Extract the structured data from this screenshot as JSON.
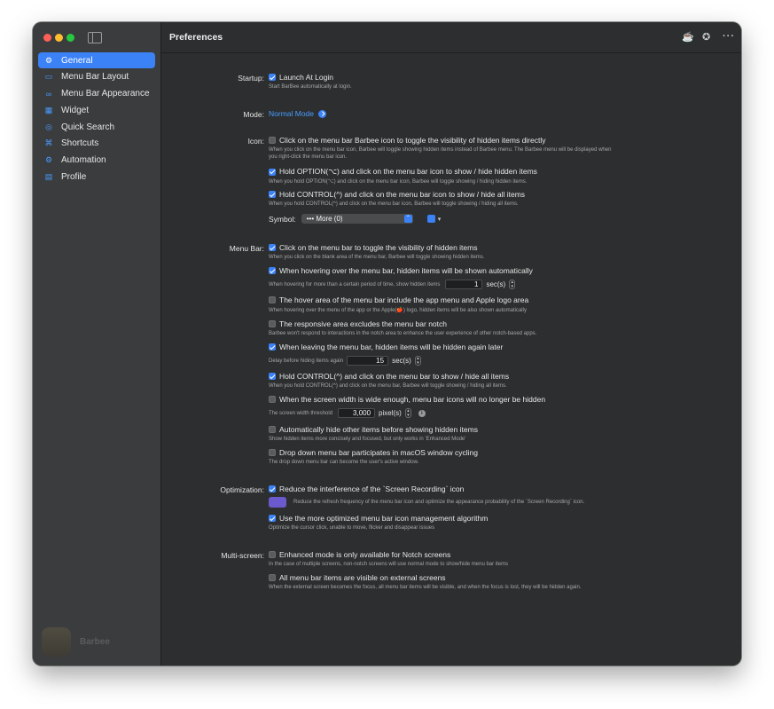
{
  "sidebar": {
    "items": [
      {
        "label": "General",
        "icon": "gear-icon",
        "glyph": "⚙",
        "active": true
      },
      {
        "label": "Menu Bar Layout",
        "icon": "layout-icon",
        "glyph": "▭",
        "active": false
      },
      {
        "label": "Menu Bar Appearance",
        "icon": "appearance-icon",
        "glyph": "∞",
        "active": false
      },
      {
        "label": "Widget",
        "icon": "widget-icon",
        "glyph": "▦",
        "active": false
      },
      {
        "label": "Quick Search",
        "icon": "search-icon",
        "glyph": "◎",
        "active": false
      },
      {
        "label": "Shortcuts",
        "icon": "shortcuts-icon",
        "glyph": "⌘",
        "active": false
      },
      {
        "label": "Automation",
        "icon": "automation-icon",
        "glyph": "⚙",
        "active": false
      },
      {
        "label": "Profile",
        "icon": "profile-icon",
        "glyph": "▤",
        "active": false
      }
    ],
    "brand_name": "Barbee"
  },
  "header": {
    "title": "Preferences"
  },
  "startup": {
    "label": "Startup:",
    "launch": {
      "label": "Launch At Login",
      "checked": true,
      "desc": "Start BarBee automatically at login."
    }
  },
  "mode": {
    "label": "Mode:",
    "value": "Normal Mode"
  },
  "icon": {
    "label": "Icon:",
    "items": [
      {
        "label": "Click on the menu bar Barbee icon to toggle the visibility of hidden items directly",
        "checked": false,
        "desc1": "When you click on the menu bar icon, Barbee will toggle showing hidden items instead of Barbee menu. The Barbee menu will be displayed when",
        "desc2": "you right-click the menu bar icon."
      },
      {
        "label": "Hold OPTION(⌥) and click on the menu bar icon to show / hide hidden items",
        "checked": true,
        "desc1": "When you hold OPTION(⌥) and click on the menu bar icon, Barbee will toggle showing / hiding hidden items."
      },
      {
        "label": "Hold CONTROL(^) and click on the menu bar icon to show / hide all items",
        "checked": true,
        "desc1": "When you hold CONTROL(^) and click on the menu bar icon, Barbee will toggle showing / hiding all items."
      }
    ],
    "symbol_label": "Symbol:",
    "symbol_value": "••• More (0)"
  },
  "menubar": {
    "label": "Menu Bar:",
    "click_toggle": {
      "label": "Click on the menu bar to toggle the visibility of hidden items",
      "checked": true,
      "desc": "When you click on the blank area of the menu bar, Barbee will toggle showing hidden items."
    },
    "hover_show": {
      "label": "When hovering over the menu bar, hidden items will be shown automatically",
      "checked": true,
      "desc": "When hovering for more than a certain period of time, show hidden items",
      "value": "1",
      "unit": "sec(s)"
    },
    "hover_area": {
      "label": "The hover area of the menu bar include the app menu and Apple logo area",
      "checked": false,
      "desc": "When hovering over the menu of the app or the Apple(🍎) logo, hidden items will be also shown automatically"
    },
    "notch": {
      "label": "The responsive area excludes the menu bar notch",
      "checked": false,
      "desc": "Barbee won't respond to interactions in the notch area to enhance the user experience of other notch-based apps."
    },
    "leave_hide": {
      "label": "When leaving the menu bar, hidden items will be hidden again later",
      "checked": true,
      "desc": "Delay before hiding items again",
      "value": "15",
      "unit": "sec(s)"
    },
    "control_all": {
      "label": "Hold CONTROL(^) and click on the menu bar to show / hide all items",
      "checked": true,
      "desc": "When you hold CONTROL(^) and click on the menu bar, Barbee will toggle showing / hiding all items."
    },
    "screen_width": {
      "label": "When the screen width is wide enough, menu bar icons will no longer be hidden",
      "checked": false,
      "desc": "The screen width threshold",
      "value": "3,000",
      "unit": "pixel(s)"
    },
    "auto_hide_other": {
      "label": "Automatically hide other items before showing hidden items",
      "checked": false,
      "desc": "Show hidden items more concisely and focused, but only works in 'Enhanced Mode'"
    },
    "dropdown_cycle": {
      "label": "Drop down menu bar participates in macOS window cycling",
      "checked": false,
      "desc": "The drop down menu bar can become the user's active window."
    }
  },
  "optimization": {
    "label": "Optimization:",
    "screen_recording": {
      "label": "Reduce the interference of the `Screen Recording` icon",
      "checked": true,
      "desc": "Reduce the refresh frequency of the menu bar icon and optimize the appearance probability of the `Screen Recording` icon."
    },
    "algorithm": {
      "label": "Use the more optimized menu bar icon management algorithm",
      "checked": true,
      "desc": "Optimize the cursor click, unable to move, flicker and disappear issues"
    }
  },
  "multiscreen": {
    "label": "Multi-screen:",
    "enhanced": {
      "label": "Enhanced mode is only available for Notch screens",
      "checked": false,
      "desc": "In the case of multiple screens, non-notch screens will use normal mode to show/hide menu bar items"
    },
    "external": {
      "label": "All menu bar items are visible on external screens",
      "checked": false,
      "desc": "When the external screen becomes the focus, all menu bar items will be visible, and when the focus is lost, they will be hidden again."
    }
  }
}
